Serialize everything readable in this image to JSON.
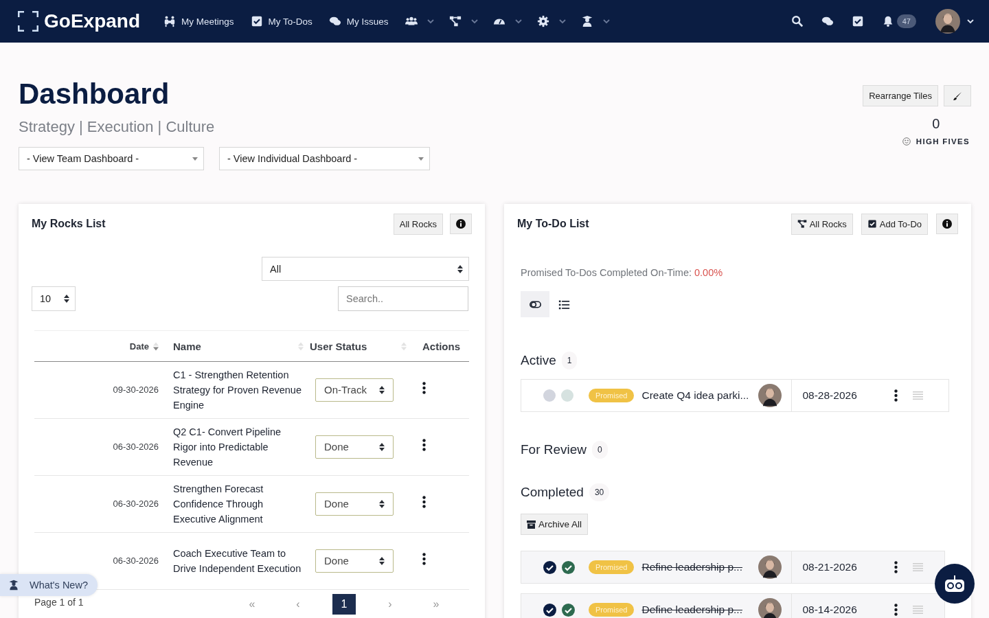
{
  "nav": {
    "logo": "GoExpand",
    "items": [
      {
        "label": "My Meetings"
      },
      {
        "label": "My To-Dos"
      },
      {
        "label": "My Issues"
      }
    ],
    "notifications": "47"
  },
  "header": {
    "title": "Dashboard",
    "subtitle": "Strategy | Execution | Culture",
    "dropdowns": [
      "- View Team Dashboard -",
      "- View Individual Dashboard -"
    ],
    "rearrange": "Rearrange Tiles",
    "high_fives": {
      "count": "0",
      "label": "HIGH FIVES"
    }
  },
  "rocks": {
    "title": "My Rocks List",
    "button": "All Rocks",
    "filter": "All",
    "page_size": "10",
    "search": {
      "placeholder": "Search.."
    },
    "columns": [
      "Date",
      "Name",
      "User Status",
      "Actions"
    ],
    "rows": [
      {
        "date": "09-30-2026",
        "name": "C1 - Strengthen Retention Strategy for Proven Revenue Engine",
        "status": "On-Track"
      },
      {
        "date": "06-30-2026",
        "name": "Q2 C1- Convert Pipeline Rigor into Predictable Revenue",
        "status": "Done"
      },
      {
        "date": "06-30-2026",
        "name": "Strengthen Forecast Confidence Through Executive Alignment",
        "status": "Done"
      },
      {
        "date": "06-30-2026",
        "name": "Coach Executive Team to Drive Independent Execution",
        "status": "Done"
      }
    ],
    "page_info": "Page 1 of 1",
    "pager": [
      {
        "label": "«",
        "selected": false
      },
      {
        "label": "‹",
        "selected": false
      },
      {
        "label": "1",
        "selected": true
      },
      {
        "label": "›",
        "selected": false
      },
      {
        "label": "»",
        "selected": false
      }
    ]
  },
  "todos": {
    "title": "My To-Do List",
    "buttons": [
      "All Rocks",
      "Add To-Do"
    ],
    "metric_label": "Promised To-Dos Completed On-Time:",
    "metric_value": "0.00%",
    "views": [
      {
        "selected": true
      },
      {
        "selected": false
      }
    ],
    "sections": [
      {
        "title": "Active",
        "count": "1",
        "items": [
          {
            "tag": "Promised",
            "text": "Create Q4 idea parki...",
            "date": "08-28-2026",
            "done": false
          }
        ]
      },
      {
        "title": "For Review",
        "count": "0"
      },
      {
        "title": "Completed",
        "count": "30",
        "archive": "Archive All",
        "items": [
          {
            "tag": "Promised",
            "text": "Refine leadership p...",
            "date": "08-21-2026",
            "done": true
          },
          {
            "tag": "Promised",
            "text": "Define leadership p...",
            "date": "08-14-2026",
            "done": true
          }
        ]
      }
    ]
  },
  "whats_new": "What's New?"
}
